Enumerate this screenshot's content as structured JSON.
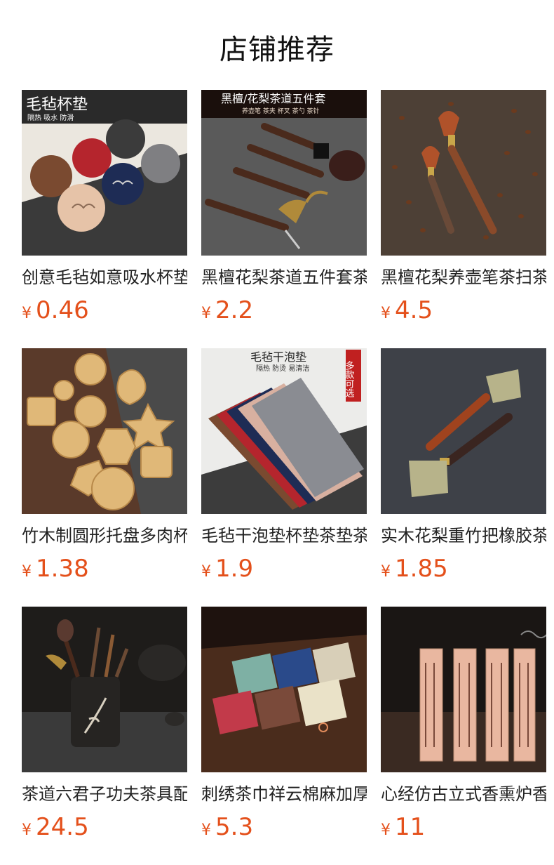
{
  "page_title": "店铺推荐",
  "currency": "¥",
  "accent_color": "#e4501b",
  "products": [
    {
      "name": "创意毛毡如意吸水杯垫",
      "price": "0.46",
      "image_text": "毛毡杯垫",
      "image_subtext": "隔热 吸水 防滑"
    },
    {
      "name": "黑檀花梨茶道五件套茶具",
      "price": "2.2",
      "image_text": "黑檀/花梨茶道五件套",
      "image_subtext": "养壶笔 茶夹 杯叉 茶勺 茶针"
    },
    {
      "name": "黑檀花梨养壶笔茶扫茶刷",
      "price": "4.5"
    },
    {
      "name": "竹木制圆形托盘多肉杯垫",
      "price": "1.38"
    },
    {
      "name": "毛毡干泡垫杯垫茶垫茶席",
      "price": "1.9",
      "image_text": "毛毡干泡垫",
      "image_subtext": "隔热 防烫 易清洁",
      "image_badge": "多款可选"
    },
    {
      "name": "实木花梨重竹把橡胶茶刮",
      "price": "1.85"
    },
    {
      "name": "茶道六君子功夫茶具配件",
      "price": "24.5"
    },
    {
      "name": "刺绣茶巾祥云棉麻加厚茶巾",
      "price": "5.3"
    },
    {
      "name": "心经仿古立式香熏炉香插",
      "price": "11"
    }
  ]
}
